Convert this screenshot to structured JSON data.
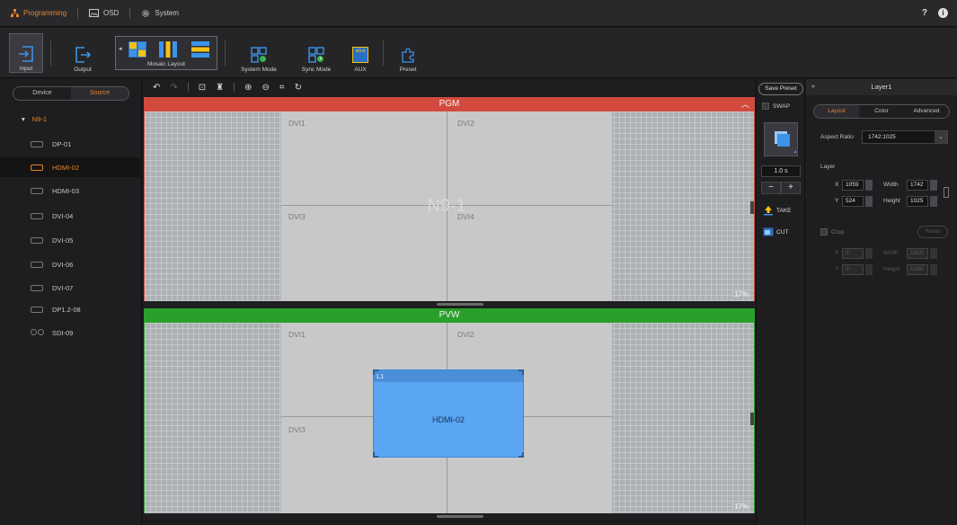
{
  "menu": {
    "tabs": [
      {
        "label": "Programming",
        "icon": "hierarchy-icon"
      },
      {
        "label": "OSD",
        "icon": "image-icon"
      },
      {
        "label": "System",
        "icon": "gear-icon"
      }
    ],
    "help": "?",
    "info": "i"
  },
  "toolbar": {
    "input_label": "Input",
    "output_label": "Output",
    "mosaic_label": "Mosaic Layout",
    "system_mode_label": "System Mode",
    "sync_mode_label": "Sync Mode",
    "aux_label": "AUX",
    "aux_icon_text": "abcd",
    "preset_label": "Preset"
  },
  "sidebar": {
    "tabs": [
      "Device",
      "Source"
    ],
    "active_tab": "Source",
    "root": "N9-1",
    "sources": [
      {
        "name": "DP-01",
        "active": false
      },
      {
        "name": "HDMI-02",
        "active": true
      },
      {
        "name": "HDMI-03",
        "active": false
      },
      {
        "name": "DVI-04",
        "active": false
      },
      {
        "name": "DVI-05",
        "active": false
      },
      {
        "name": "DVI-06",
        "active": false
      },
      {
        "name": "DVI-07",
        "active": false
      },
      {
        "name": "DP1.2-08",
        "active": false
      },
      {
        "name": "SDI-09",
        "active": false
      }
    ]
  },
  "pgm": {
    "title": "PGM",
    "cells": [
      "DVI1",
      "DVI2",
      "DVI3",
      "DVI4"
    ],
    "watermark": "N9-1",
    "zoom": "17%"
  },
  "pvw": {
    "title": "PVW",
    "cells": [
      "DVI1",
      "DVI2",
      "DVI3"
    ],
    "layer_name": "L1",
    "layer_source": "HDMI-02",
    "zoom": "17%"
  },
  "controls": {
    "save_preset": "Save Preset",
    "swap": "SWAP",
    "duration": "1.0 s",
    "minus": "−",
    "plus": "+",
    "take": "TAKE",
    "cut": "CUT"
  },
  "properties": {
    "title": "Layer1",
    "tabs": [
      "Layout",
      "Color",
      "Advanced"
    ],
    "active_tab": "Layout",
    "aspect_ratio_label": "Aspect Ratio",
    "aspect_ratio_value": "1742:1025",
    "layer_heading": "Layer",
    "x_label": "X",
    "x_value": "1059",
    "y_label": "Y",
    "y_value": "524",
    "width_label": "Width",
    "width_value": "1742",
    "height_label": "Height",
    "height_value": "1025",
    "crop_label": "Crop",
    "reset_label": "Reset",
    "crop_x_value": "0",
    "crop_y_value": "0",
    "crop_width_value": "1920",
    "crop_height_value": "1080"
  },
  "colors": {
    "accent": "#e8832a",
    "pgm": "#d24a3e",
    "pvw": "#2aa02a",
    "layer": "#5aa6f4"
  }
}
